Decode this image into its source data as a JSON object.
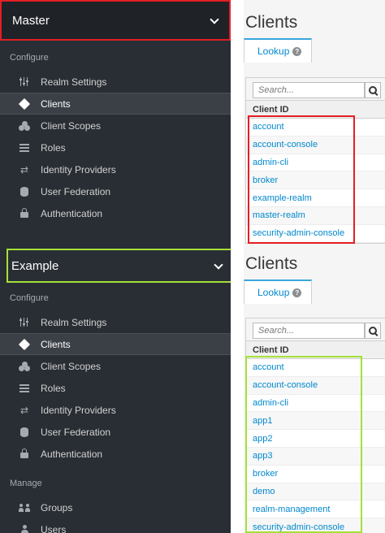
{
  "top": {
    "realm_name": "Master",
    "section_configure": "Configure",
    "nav": [
      {
        "label": "Realm Settings",
        "icon": "sliders-icon"
      },
      {
        "label": "Clients",
        "icon": "cube-icon",
        "active": true
      },
      {
        "label": "Client Scopes",
        "icon": "scopes-icon"
      },
      {
        "label": "Roles",
        "icon": "roles-icon"
      },
      {
        "label": "Identity Providers",
        "icon": "exchange-icon"
      },
      {
        "label": "User Federation",
        "icon": "database-icon"
      },
      {
        "label": "Authentication",
        "icon": "lock-icon"
      }
    ],
    "page_title": "Clients",
    "tab_label": "Lookup",
    "search_placeholder": "Search...",
    "column_header": "Client ID",
    "clients": [
      "account",
      "account-console",
      "admin-cli",
      "broker",
      "example-realm",
      "master-realm",
      "security-admin-console"
    ]
  },
  "bottom": {
    "realm_name": "Example",
    "section_configure": "Configure",
    "section_manage": "Manage",
    "nav": [
      {
        "label": "Realm Settings",
        "icon": "sliders-icon"
      },
      {
        "label": "Clients",
        "icon": "cube-icon",
        "active": true
      },
      {
        "label": "Client Scopes",
        "icon": "scopes-icon"
      },
      {
        "label": "Roles",
        "icon": "roles-icon"
      },
      {
        "label": "Identity Providers",
        "icon": "exchange-icon"
      },
      {
        "label": "User Federation",
        "icon": "database-icon"
      },
      {
        "label": "Authentication",
        "icon": "lock-icon"
      }
    ],
    "manage_nav": [
      {
        "label": "Groups",
        "icon": "group-icon"
      },
      {
        "label": "Users",
        "icon": "user-icon"
      }
    ],
    "page_title": "Clients",
    "tab_label": "Lookup",
    "search_placeholder": "Search...",
    "column_header": "Client ID",
    "clients": [
      "account",
      "account-console",
      "admin-cli",
      "app1",
      "app2",
      "app3",
      "broker",
      "demo",
      "realm-management",
      "security-admin-console"
    ]
  },
  "colors": {
    "sidebar_bg": "#292e34",
    "accent_blue": "#0088ce",
    "highlight_red": "#e41e26",
    "highlight_green": "#a4e03a"
  }
}
